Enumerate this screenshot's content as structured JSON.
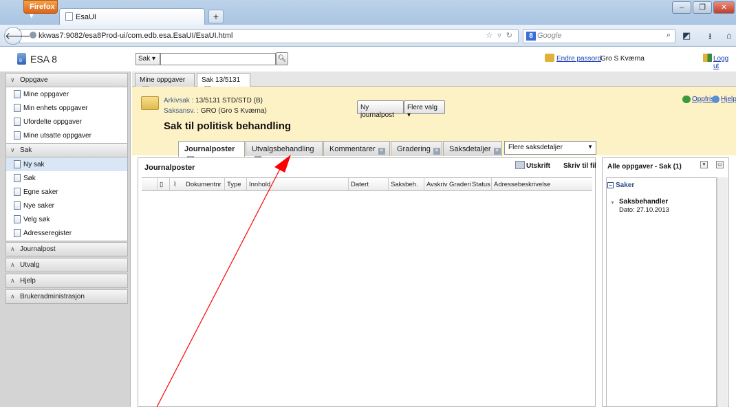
{
  "browser": {
    "menu_label": "Firefox ▾",
    "tab_title": "EsaUI",
    "new_tab": "+",
    "url": "kkwas7:9082/esa8Prod-ui/com.edb.esa.EsaUI/EsaUI.html",
    "search_engine": "Google",
    "win_min": "‒",
    "win_max": "❐",
    "win_close": "✕"
  },
  "app": {
    "name": "ESA 8",
    "logo_num": "8",
    "search_type": "Sak ▾",
    "search_value": "",
    "change_password": "Endre passord",
    "user": "Gro S Kværna",
    "logout": "Logg ut"
  },
  "sidebar": {
    "groups": [
      {
        "label": "Oppgave",
        "expanded": true,
        "items": [
          "Mine oppgaver",
          "Min enhets oppgaver",
          "Ufordelte oppgaver",
          "Mine utsatte oppgaver"
        ]
      },
      {
        "label": "Sak",
        "expanded": true,
        "items": [
          "Ny sak",
          "Søk",
          "Egne saker",
          "Nye saker",
          "Velg søk",
          "Adresseregister"
        ]
      },
      {
        "label": "Journalpost",
        "expanded": false
      },
      {
        "label": "Utvalg",
        "expanded": false
      },
      {
        "label": "Hjelp",
        "expanded": false
      },
      {
        "label": "Brukeradministrasjon",
        "expanded": false
      }
    ],
    "selected_item": "Ny sak"
  },
  "main_tabs": [
    "Mine oppgaver",
    "Sak 13/5131"
  ],
  "case": {
    "arkivsak_label": "Arkivsak :",
    "arkivsak_value": "13/5131 STD/STD (B)",
    "saksansv_label": "Saksansv. :",
    "saksansv_value": "GRO (Gro S Kværna)",
    "title": "Sak til politisk behandling",
    "btn_new_journal": "Ny journalpost",
    "btn_more": "Flere valg ▾",
    "refresh": "Oppfrisk",
    "help": "Hjelp"
  },
  "sub_tabs": [
    "Journalposter",
    "Utvalgsbehandling",
    "Kommentarer",
    "Gradering",
    "Saksdetaljer"
  ],
  "more_details": "Flere saksdetaljer",
  "journal": {
    "title": "Journalposter",
    "print": "Utskrift",
    "to_file": "Skriv til fil",
    "columns": [
      "Dokumentnr",
      "Type",
      "Innhold",
      "Datert",
      "Saksbeh.",
      "Avskriv",
      "Graderi",
      "Status",
      "Adressebeskrivelse"
    ]
  },
  "tasks": {
    "title": "Alle oppgaver - Sak (1)",
    "section": "Saker",
    "item_title": "Saksbehandler",
    "item_date": "Dato: 27.10.2013"
  },
  "colors": {
    "case_header_bg": "#fdf2c6",
    "annotation_arrow": "#ff0000",
    "link": "#1a3fb5"
  }
}
